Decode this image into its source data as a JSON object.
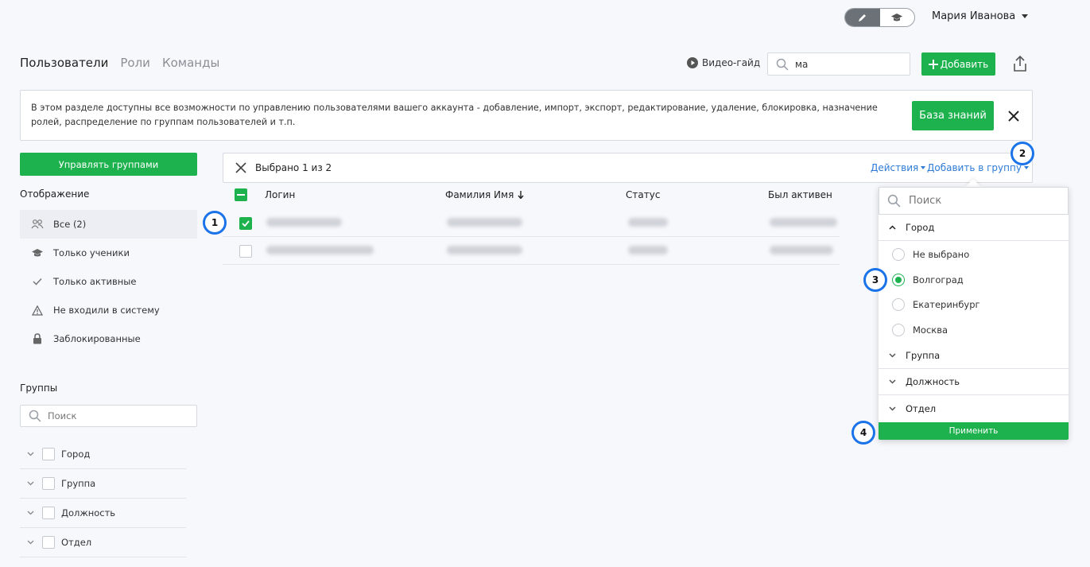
{
  "header": {
    "user_name": "Мария Иванова",
    "mode_icons": [
      "pencil-icon",
      "graduation-cap-icon"
    ]
  },
  "tabs": [
    {
      "label": "Пользователи",
      "active": true
    },
    {
      "label": "Роли",
      "active": false
    },
    {
      "label": "Команды",
      "active": false
    }
  ],
  "toolbar": {
    "video_guide": "Видео-гайд",
    "search_value": "ма",
    "add_label": "Добавить"
  },
  "banner": {
    "text": "В этом разделе доступны все возможности по управлению пользователями вашего аккаунта - добавление, импорт, экспорт, редактирование, удаление, блокировка, назначение ролей, распределение по группам пользователей и т.п.",
    "kb_label": "База знаний"
  },
  "sidebar": {
    "manage_groups_label": "Управлять группами",
    "display_title": "Отображение",
    "views": [
      {
        "label": "Все (2)",
        "icon": "users-icon",
        "active": true
      },
      {
        "label": "Только ученики",
        "icon": "graduation-cap-icon",
        "active": false
      },
      {
        "label": "Только активные",
        "icon": "check-icon",
        "active": false
      },
      {
        "label": "Не входили в систему",
        "icon": "warning-icon",
        "active": false
      },
      {
        "label": "Заблокированные",
        "icon": "lock-icon",
        "active": false
      }
    ],
    "groups_title": "Группы",
    "groups_search_placeholder": "Поиск",
    "groups": [
      "Город",
      "Группа",
      "Должность",
      "Отдел"
    ]
  },
  "selection": {
    "text": "Выбрано 1 из 2",
    "actions_label": "Действия",
    "add_to_group_label": "Добавить в группу"
  },
  "table": {
    "columns": [
      "Логин",
      "Фамилия Имя",
      "Статус",
      "Был активен"
    ],
    "rows": [
      {
        "checked": true
      },
      {
        "checked": false
      }
    ]
  },
  "dropdown": {
    "search_placeholder": "Поиск",
    "expanded_group": "Город",
    "options": [
      {
        "label": "Не выбрано",
        "selected": false
      },
      {
        "label": "Волгоград",
        "selected": true
      },
      {
        "label": "Екатеринбург",
        "selected": false
      },
      {
        "label": "Москва",
        "selected": false
      }
    ],
    "collapsed_groups": [
      "Группа",
      "Должность",
      "Отдел"
    ],
    "apply_label": "Применить"
  },
  "markers": [
    "1",
    "2",
    "3",
    "4"
  ],
  "colors": {
    "accent_green": "#1eb24f",
    "link_blue": "#2d7bd6",
    "marker_blue": "#1a73e8"
  }
}
